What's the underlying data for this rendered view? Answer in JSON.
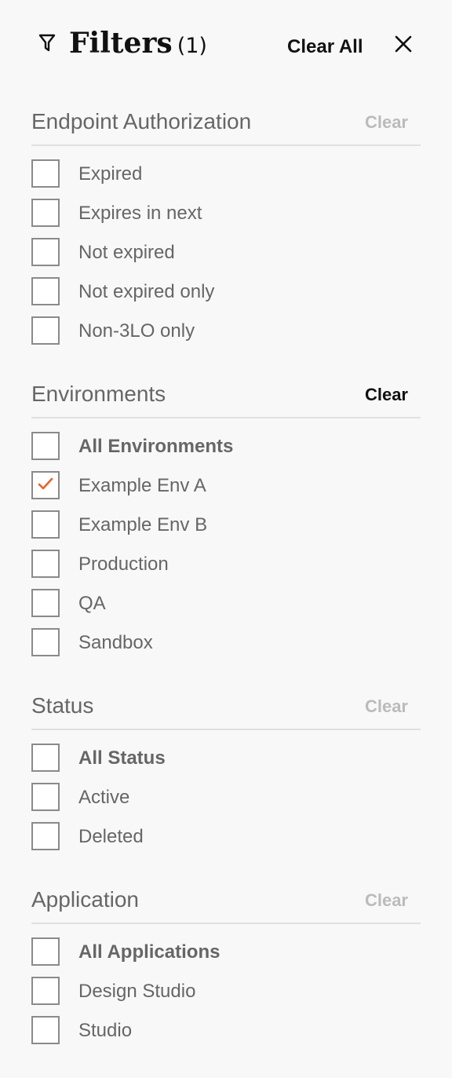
{
  "header": {
    "title": "Filters",
    "count": "(1)",
    "clear_all_label": "Clear All",
    "filter_icon": "funnel-icon",
    "close_icon": "close-icon"
  },
  "colors": {
    "accent": "#e8632b",
    "clear_active": "#111111",
    "clear_inactive": "#bbbbbb"
  },
  "sections": [
    {
      "title": "Endpoint Authorization",
      "clear_label": "Clear",
      "clear_active": false,
      "options": [
        {
          "label": "Expired",
          "checked": false
        },
        {
          "label": "Expires in next",
          "checked": false
        },
        {
          "label": "Not expired",
          "checked": false
        },
        {
          "label": "Not expired only",
          "checked": false
        },
        {
          "label": "Non-3LO only",
          "checked": false
        }
      ]
    },
    {
      "title": "Environments",
      "clear_label": "Clear",
      "clear_active": true,
      "options": [
        {
          "label": "All Environments",
          "checked": false
        },
        {
          "label": "Example Env A",
          "checked": true
        },
        {
          "label": "Example Env B",
          "checked": false
        },
        {
          "label": "Production",
          "checked": false
        },
        {
          "label": "QA",
          "checked": false
        },
        {
          "label": "Sandbox",
          "checked": false
        }
      ]
    },
    {
      "title": "Status",
      "clear_label": "Clear",
      "clear_active": false,
      "options": [
        {
          "label": "All Status",
          "checked": false
        },
        {
          "label": "Active",
          "checked": false
        },
        {
          "label": "Deleted",
          "checked": false
        }
      ]
    },
    {
      "title": "Application",
      "clear_label": "Clear",
      "clear_active": false,
      "options": [
        {
          "label": "All Applications",
          "checked": false
        },
        {
          "label": "Design Studio",
          "checked": false
        },
        {
          "label": "Studio",
          "checked": false
        }
      ]
    }
  ]
}
